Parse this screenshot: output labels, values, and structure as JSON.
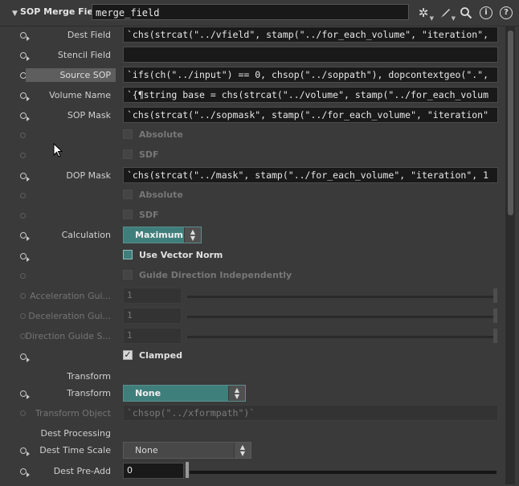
{
  "header": {
    "node_type": "SOP Merge Field",
    "node_name": "merge_field",
    "icons": [
      "gear-icon",
      "brush-icon",
      "search-icon",
      "info-icon",
      "help-icon"
    ]
  },
  "params": {
    "dest_field": {
      "label": "Dest Field",
      "value": "`chs(strcat(\"../vfield\", stamp(\"../for_each_volume\", \"iteration\","
    },
    "stencil_field": {
      "label": "Stencil Field",
      "value": ""
    },
    "source_sop": {
      "label": "Source SOP",
      "value": "`ifs(ch(\"../input\") == 0, chsop(\"../soppath\"), dopcontextgeo(\".\","
    },
    "volume_name": {
      "label": "Volume Name",
      "value": "`{¶string base = chs(strcat(\"../volume\", stamp(\"../for_each_volum"
    },
    "sop_mask": {
      "label": "SOP Mask",
      "value": "`chs(strcat(\"../sopmask\", stamp(\"../for_each_volume\", \"iteration\""
    },
    "sop_absolute": {
      "label": "Absolute"
    },
    "sop_sdf": {
      "label": "SDF"
    },
    "dop_mask": {
      "label": "DOP Mask",
      "value": "`chs(strcat(\"../mask\", stamp(\"../for_each_volume\", \"iteration\", 1"
    },
    "dop_absolute": {
      "label": "Absolute"
    },
    "dop_sdf": {
      "label": "SDF"
    },
    "calculation": {
      "label": "Calculation",
      "value": "Maximum"
    },
    "use_vector_norm": {
      "label": "Use Vector Norm"
    },
    "guide_direction": {
      "label": "Guide Direction Independently"
    },
    "acceleration_guide": {
      "label": "Acceleration Gui...",
      "value": "1"
    },
    "deceleration_guide": {
      "label": "Deceleration Gui...",
      "value": "1"
    },
    "direction_guide": {
      "label": "Direction Guide S...",
      "value": "1"
    },
    "clamped": {
      "label": "Clamped"
    },
    "transform_heading": {
      "label": "Transform"
    },
    "transform": {
      "label": "Transform",
      "value": "None"
    },
    "transform_object": {
      "label": "Transform Object",
      "value": "`chsop(\"../xformpath\")`"
    },
    "dest_processing_heading": {
      "label": "Dest Processing"
    },
    "dest_time_scale": {
      "label": "Dest Time Scale",
      "value": "None"
    },
    "dest_pre_add": {
      "label": "Dest Pre-Add",
      "value": "0"
    }
  }
}
